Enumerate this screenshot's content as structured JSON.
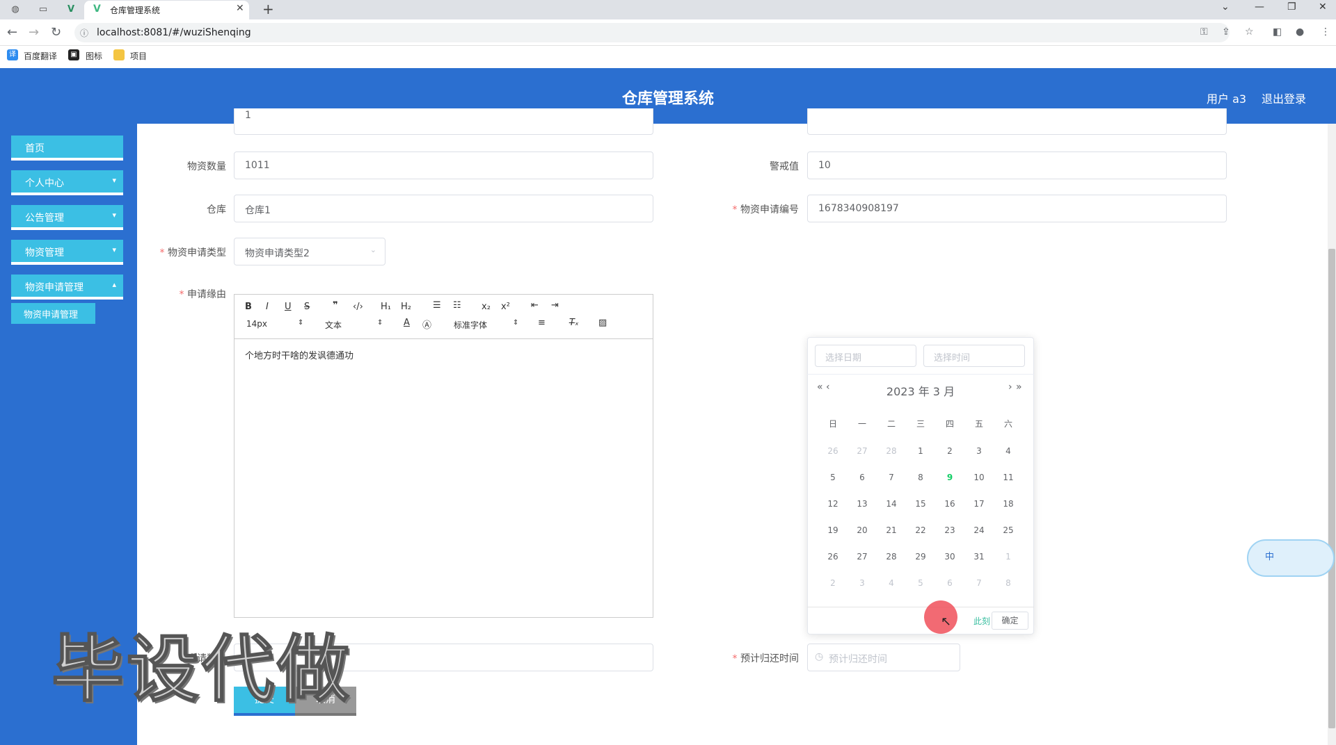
{
  "browser": {
    "tab_title": "仓库管理系统",
    "url": "localhost:8081/#/wuziShenqing",
    "bookmarks": [
      "百度翻译",
      "图标",
      "项目"
    ]
  },
  "header": {
    "title": "仓库管理系统",
    "user": "用户 a3",
    "logout": "退出登录"
  },
  "sidebar": {
    "items": [
      {
        "label": "首页"
      },
      {
        "label": "个人中心"
      },
      {
        "label": "公告管理"
      },
      {
        "label": "物资管理"
      },
      {
        "label": "物资申请管理"
      }
    ],
    "submenu": "物资申请管理"
  },
  "form": {
    "quantity_label": "物资数量",
    "quantity_value": "1011",
    "warning_label": "警戒值",
    "warning_value": "10",
    "warehouse_label": "仓库",
    "warehouse_value": "仓库1",
    "apply_no_label": "物资申请编号",
    "apply_no_value": "1678340908197",
    "apply_type_label": "物资申请类型",
    "apply_type_value": "物资申请类型2",
    "reason_label": "申请缘由",
    "reason_value": "个地方时干啥的发讽德通功",
    "apply_count_label": "申请数量",
    "apply_count_value": "3",
    "return_time_label": "预计归还时间",
    "return_time_placeholder": "预计归还时间",
    "submit": "提交",
    "cancel": "取消",
    "top_value": "1"
  },
  "editor": {
    "font_size": "14px",
    "block": "文本",
    "font": "标准字体",
    "h1": "H₁",
    "h2": "H₂",
    "sub": "x₂",
    "sup": "x²"
  },
  "picker": {
    "date_placeholder": "选择日期",
    "time_placeholder": "选择时间",
    "title": "2023 年  3 月",
    "now": "此刻",
    "ok": "确定",
    "weekdays": [
      "日",
      "一",
      "二",
      "三",
      "四",
      "五",
      "六"
    ],
    "weeks": [
      [
        "26",
        "27",
        "28",
        "1",
        "2",
        "3",
        "4"
      ],
      [
        "5",
        "6",
        "7",
        "8",
        "9",
        "10",
        "11"
      ],
      [
        "12",
        "13",
        "14",
        "15",
        "16",
        "17",
        "18"
      ],
      [
        "19",
        "20",
        "21",
        "22",
        "23",
        "24",
        "25"
      ],
      [
        "26",
        "27",
        "28",
        "29",
        "30",
        "31",
        "1"
      ],
      [
        "2",
        "3",
        "4",
        "5",
        "6",
        "7",
        "8"
      ]
    ],
    "today": "9"
  },
  "watermark": "毕设代做",
  "widget": "中"
}
